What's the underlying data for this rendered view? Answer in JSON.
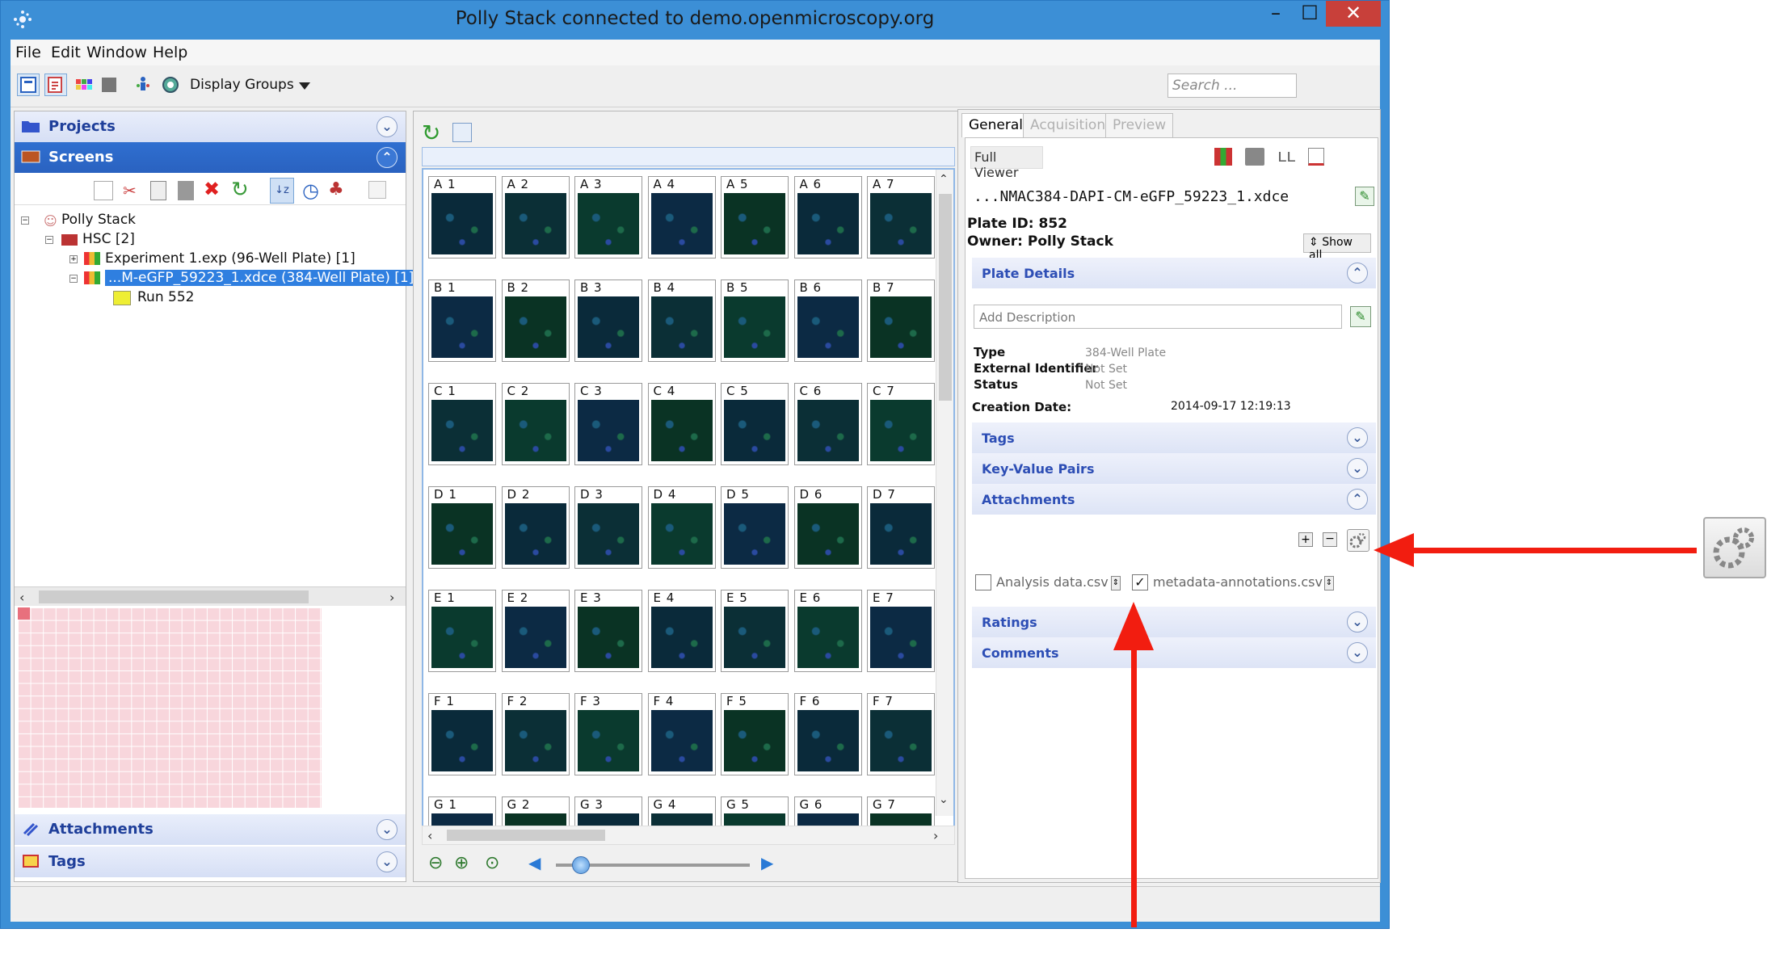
{
  "window": {
    "title": "Polly Stack connected to demo.openmicroscopy.org",
    "minimize": "–",
    "maximize": "☐",
    "close": "✕"
  },
  "menu": [
    "File",
    "Edit",
    "Window",
    "Help"
  ],
  "toolbar": {
    "display_groups": "Display Groups",
    "search_placeholder": "Search ..."
  },
  "left": {
    "projects": "Projects",
    "screens": "Screens",
    "tree": [
      {
        "label": "Polly Stack"
      },
      {
        "label": "HSC [2]"
      },
      {
        "label": "Experiment 1.exp (96-Well Plate) [1]"
      },
      {
        "label": "...M-eGFP_59223_1.xdce (384-Well Plate) [1]"
      },
      {
        "label": "Run 552"
      }
    ],
    "attachments": "Attachments",
    "tags": "Tags"
  },
  "wells": {
    "rows": [
      "A",
      "B",
      "C",
      "D",
      "E",
      "F",
      "G"
    ],
    "cols": [
      "1",
      "2",
      "3",
      "4",
      "5",
      "6",
      "7"
    ]
  },
  "right": {
    "tabs": [
      "General",
      "Acquisition",
      "Preview"
    ],
    "full_viewer": "Full Viewer",
    "name": "...NMAC384-DAPI-CM-eGFP_59223_1.xdce",
    "plate_id": "Plate ID: 852",
    "owner": "Owner: Polly Stack",
    "show_all": "Show all",
    "plate_details": "Plate Details",
    "description_placeholder": "Add Description",
    "type_label": "Type",
    "type_value": "384-Well Plate",
    "ext_id_label": "External Identifier",
    "ext_id_value": "Not Set",
    "status_label": "Status",
    "status_value": "Not Set",
    "creation_label": "Creation Date:",
    "creation_value": "2014-09-17 12:19:13",
    "tags": "Tags",
    "kv_pairs": "Key-Value Pairs",
    "attachments": "Attachments",
    "files": [
      {
        "name": "Analysis data.csv",
        "checked": false
      },
      {
        "name": "metadata-annotations.csv",
        "checked": true
      }
    ],
    "ratings": "Ratings",
    "comments": "Comments"
  },
  "colors": {
    "titlebar": "#3c8fd6",
    "selection": "#2f7fe0",
    "arrow": "#f21d10"
  }
}
